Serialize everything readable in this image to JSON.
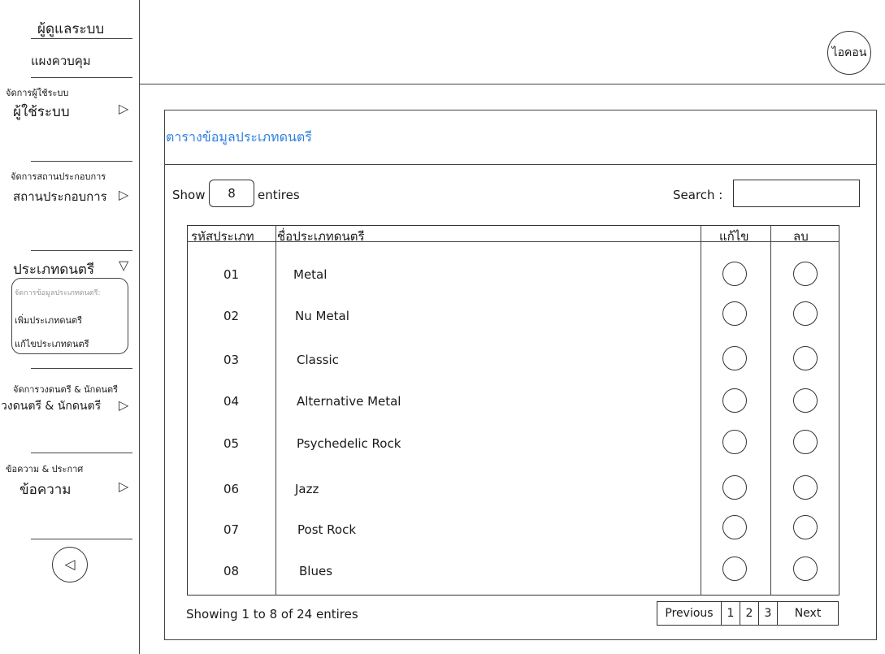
{
  "sidebar": {
    "title": "ผู้ดูแลระบบ",
    "dashboard": "แผงควบคุม",
    "sections": [
      {
        "caption": "จัดการผู้ใช้ระบบ",
        "label": "ผู้ใช้ระบบ"
      },
      {
        "caption": "จัดการสถานประกอบการ",
        "label": "สถานประกอบการ"
      },
      {
        "caption": "",
        "label": "ประเภทดนตรี"
      },
      {
        "caption": "จัดการวงดนตรี & นักดนตรี",
        "label": "วงดนตรี & นักดนตรี"
      },
      {
        "caption": "ข้อความ & ประกาศ",
        "label": "ข้อความ"
      }
    ],
    "submenu": {
      "caption": "จัดการข้อมูลประเภทดนตรี:",
      "items": [
        "เพิ่มประเภทดนตรี",
        "แก้ไขประเภทดนตรี"
      ]
    },
    "collapse_icon": "triangle-left-icon"
  },
  "header": {
    "avatar_label": "ไอคอน"
  },
  "panel": {
    "title": "ตารางข้อมูลประเภทดนตรี",
    "title_color": "#2f7fe0",
    "show_label": "Show",
    "show_value": "8",
    "entries_label": "entires",
    "search_label": "Search :",
    "search_value": ""
  },
  "table": {
    "columns": [
      "รหัสประเภท",
      "ชื่อประเภทดนตรี",
      "แก้ไข",
      "ลบ"
    ],
    "rows": [
      {
        "id": "01",
        "name": "Metal"
      },
      {
        "id": "02",
        "name": "Nu Metal"
      },
      {
        "id": "03",
        "name": "Classic"
      },
      {
        "id": "04",
        "name": "Alternative Metal"
      },
      {
        "id": "05",
        "name": "Psychedelic Rock"
      },
      {
        "id": "06",
        "name": "Jazz"
      },
      {
        "id": "07",
        "name": "Post Rock"
      },
      {
        "id": "08",
        "name": "Blues"
      }
    ]
  },
  "footer": {
    "info": "Showing 1 to 8 of 24 entires",
    "previous": "Previous",
    "pages": [
      "1",
      "2",
      "3"
    ],
    "next": "Next"
  }
}
